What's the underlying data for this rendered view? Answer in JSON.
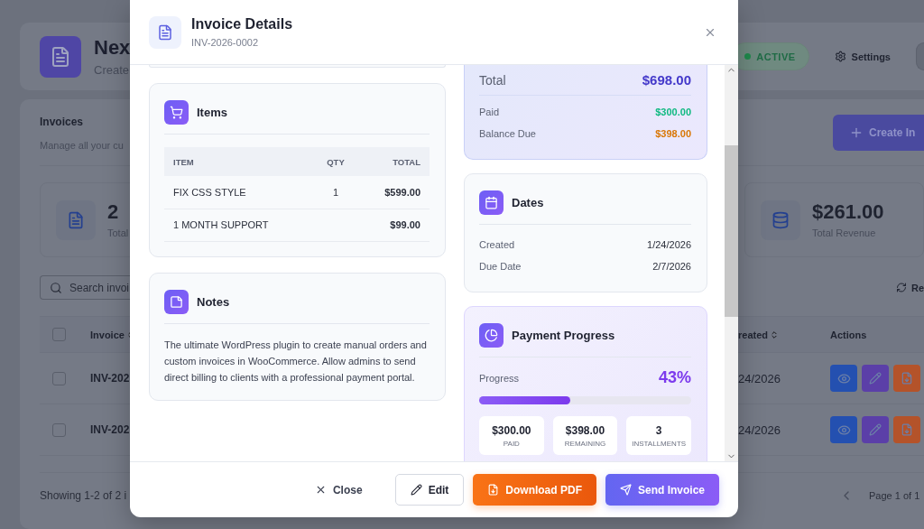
{
  "background": {
    "header": {
      "title": "Nex",
      "subtitle": "Create",
      "status": "ACTIVE",
      "settings": "Settings"
    },
    "invoices": {
      "title": "Invoices",
      "subtitle": "Manage all your cu",
      "create_button": "Create In"
    },
    "stats": [
      {
        "value": "2",
        "label": "Total"
      },
      {
        "value": "$261.00",
        "label": "Total Revenue"
      }
    ],
    "search": {
      "placeholder": "Search invoi"
    },
    "refresh": "Re",
    "table": {
      "all_checked": false,
      "columns": [
        "Invoice",
        "reated",
        "Actions"
      ],
      "rows": [
        {
          "checked": false,
          "invoice": "INV-202",
          "created": "24/2026"
        },
        {
          "checked": false,
          "invoice": "INV-202",
          "created": "24/2026"
        }
      ]
    },
    "footer": {
      "showing": "Showing 1-2 of 2 i",
      "page": "Page 1 of 1"
    }
  },
  "modal": {
    "title": "Invoice Details",
    "subtitle": "INV-2026-0002",
    "items": {
      "title": "Items",
      "columns": [
        "ITEM",
        "QTY",
        "TOTAL"
      ],
      "rows": [
        [
          "FIX CSS STYLE",
          "1",
          "$599.00"
        ],
        [
          "1 MONTH SUPPORT",
          "",
          "$99.00"
        ]
      ]
    },
    "notes": {
      "title": "Notes",
      "text": "The ultimate WordPress plugin to create manual orders and custom invoices in WooCommerce. Allow admins to send direct billing to clients with a professional payment portal."
    },
    "totals": [
      {
        "kind": "total",
        "label": "Total",
        "value": "$698.00"
      },
      {
        "kind": "paid",
        "label": "Paid",
        "value": "$300.00"
      },
      {
        "kind": "due",
        "label": "Balance Due",
        "value": "$398.00"
      }
    ],
    "dates": {
      "title": "Dates",
      "rows": [
        {
          "label": "Created",
          "value": "1/24/2026"
        },
        {
          "label": "Due Date",
          "value": "2/7/2026"
        }
      ]
    },
    "progress": {
      "title": "Payment Progress",
      "label": "Progress",
      "percent": "43%",
      "level": 0.43,
      "stats": [
        {
          "value": "$300.00",
          "label": "PAID"
        },
        {
          "value": "$398.00",
          "label": "REMAINING"
        },
        {
          "value": "3",
          "label": "INSTALLMENTS"
        }
      ]
    },
    "buttons": [
      {
        "kind": "ghost",
        "label": "Close"
      },
      {
        "kind": "outline",
        "label": "Edit"
      },
      {
        "kind": "pdf",
        "label": "Download PDF"
      },
      {
        "kind": "primary",
        "label": "Send Invoice"
      }
    ]
  }
}
